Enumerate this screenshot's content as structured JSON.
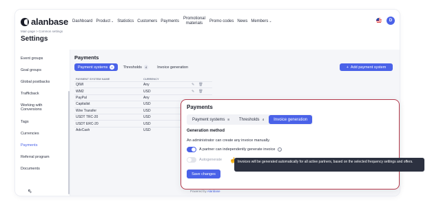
{
  "app": {
    "logo_text": "alanbase",
    "avatar_initial": "D"
  },
  "nav": {
    "items": [
      {
        "label": "Dashboard"
      },
      {
        "label": "Product",
        "chevron": true
      },
      {
        "label": "Statistics"
      },
      {
        "label": "Customers"
      },
      {
        "label": "Payments"
      },
      {
        "label": "Promotional materials",
        "two_line": true
      },
      {
        "label": "Promo codes"
      },
      {
        "label": "News"
      },
      {
        "label": "Members",
        "chevron": true
      }
    ]
  },
  "breadcrumb": "Main page > Common settings",
  "page_title": "Settings",
  "sidebar": {
    "items": [
      {
        "label": "Event groups"
      },
      {
        "label": "Goal groups"
      },
      {
        "label": "Global postbacks"
      },
      {
        "label": "Trafficback"
      },
      {
        "label": "Working with Conversions"
      },
      {
        "label": "Tags"
      },
      {
        "label": "Currencies"
      },
      {
        "label": "Payments",
        "active": true
      },
      {
        "label": "Referral program"
      },
      {
        "label": "Documents"
      }
    ]
  },
  "main": {
    "title": "Payments",
    "tabs": [
      {
        "label": "Payment systems",
        "count": "8",
        "active": true
      },
      {
        "label": "Thresholds",
        "count": "4",
        "active": false
      },
      {
        "label": "Invoice generation",
        "count": "",
        "active": false
      }
    ],
    "add_button": "Add payment system",
    "table": {
      "headers": [
        "PAYMENT SYSTEM NAME",
        "CURRENCY"
      ],
      "rows": [
        [
          "QIWI",
          "Any"
        ],
        [
          "WM2",
          "USD"
        ],
        [
          "PayPal",
          "Any"
        ],
        [
          "Capitalist",
          "USD"
        ],
        [
          "Wire Transfer",
          "USD"
        ],
        [
          "USDT TRC-20",
          "USD"
        ],
        [
          "USDT ERC-20",
          "USD"
        ],
        [
          "AdvCash",
          "USD"
        ]
      ]
    },
    "powered_prefix": "Powered by",
    "powered_brand": "Alanbase"
  },
  "zoom": {
    "title": "Payments",
    "tabs": [
      {
        "label": "Payment systems",
        "count": "8",
        "active": false
      },
      {
        "label": "Thresholds",
        "count": "4",
        "active": false
      },
      {
        "label": "Invoice generation",
        "count": "",
        "active": true
      }
    ],
    "generation_heading": "Generation method",
    "admin_text": "An administrator can create any invoice manually.",
    "partner_toggle": {
      "label": "A partner can independently generate invoice",
      "on": true
    },
    "auto_toggle": {
      "label": "Autogenerate",
      "on": false
    },
    "tooltip": "Invoices will be generated automatically for all active partners, based on the selected frequency settings and offers.",
    "save_button": "Save changes"
  },
  "colors": {
    "accent": "#4a62e8",
    "highlight_border": "#b3384a",
    "tooltip_bg": "#2c3140"
  },
  "icons": {
    "edit": "pencil-icon",
    "delete": "trash-icon",
    "plus": "plus-icon",
    "info": "info-icon"
  }
}
